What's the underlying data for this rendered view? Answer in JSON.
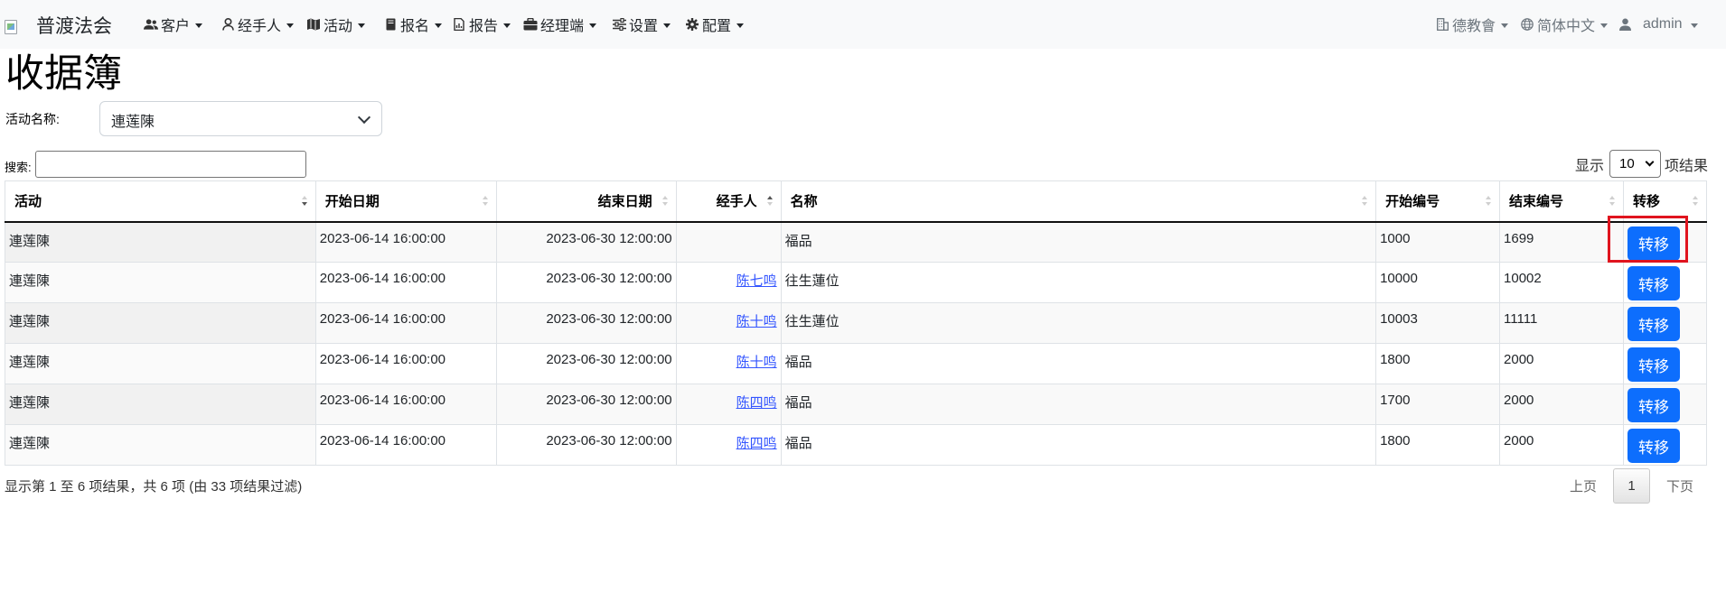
{
  "navbar": {
    "brand": "普渡法会",
    "menus": [
      {
        "label": "客户",
        "icon": "users-icon"
      },
      {
        "label": "经手人",
        "icon": "user-icon"
      },
      {
        "label": "活动",
        "icon": "map-icon"
      },
      {
        "label": "报名",
        "icon": "book-icon"
      },
      {
        "label": "报告",
        "icon": "report-icon"
      },
      {
        "label": "经理端",
        "icon": "briefcase-icon"
      },
      {
        "label": "设置",
        "icon": "sliders-icon"
      },
      {
        "label": "配置",
        "icon": "gear-icon"
      }
    ],
    "right": {
      "org": "德教會",
      "language": "简体中文",
      "user": "admin"
    }
  },
  "page": {
    "title": "收据簿",
    "filter_label": "活动名称:",
    "filter_value": "連莲陳",
    "search_label": "搜索:",
    "search_value": "",
    "length_prefix": "显示",
    "length_value": "10",
    "length_suffix": "项结果"
  },
  "table": {
    "columns": [
      "活动",
      "开始日期",
      "结束日期",
      "经手人",
      "名称",
      "开始编号",
      "结束编号",
      "转移"
    ],
    "rows": [
      {
        "activity": "連莲陳",
        "start": "2023-06-14 16:00:00",
        "end": "2023-06-30 12:00:00",
        "agent": "",
        "name": "福品",
        "start_no": "1000",
        "end_no": "1699",
        "action": "转移"
      },
      {
        "activity": "連莲陳",
        "start": "2023-06-14 16:00:00",
        "end": "2023-06-30 12:00:00",
        "agent": "陈七鸣",
        "name": "往生蓮位",
        "start_no": "10000",
        "end_no": "10002",
        "action": "转移"
      },
      {
        "activity": "連莲陳",
        "start": "2023-06-14 16:00:00",
        "end": "2023-06-30 12:00:00",
        "agent": "陈十鸣",
        "name": "往生蓮位",
        "start_no": "10003",
        "end_no": "11111",
        "action": "转移"
      },
      {
        "activity": "連莲陳",
        "start": "2023-06-14 16:00:00",
        "end": "2023-06-30 12:00:00",
        "agent": "陈十鸣",
        "name": "福品",
        "start_no": "1800",
        "end_no": "2000",
        "action": "转移"
      },
      {
        "activity": "連莲陳",
        "start": "2023-06-14 16:00:00",
        "end": "2023-06-30 12:00:00",
        "agent": "陈四鸣",
        "name": "福品",
        "start_no": "1700",
        "end_no": "2000",
        "action": "转移"
      },
      {
        "activity": "連莲陳",
        "start": "2023-06-14 16:00:00",
        "end": "2023-06-30 12:00:00",
        "agent": "陈四鸣",
        "name": "福品",
        "start_no": "1800",
        "end_no": "2000",
        "action": "转移"
      }
    ]
  },
  "footer": {
    "info": "显示第 1 至 6 项结果，共 6 项 (由 33 项结果过滤)",
    "prev": "上页",
    "current": "1",
    "next": "下页"
  },
  "colors": {
    "navbar_bg": "#f8f9fa",
    "primary": "#0d6efd",
    "highlight": "#e0141e"
  }
}
